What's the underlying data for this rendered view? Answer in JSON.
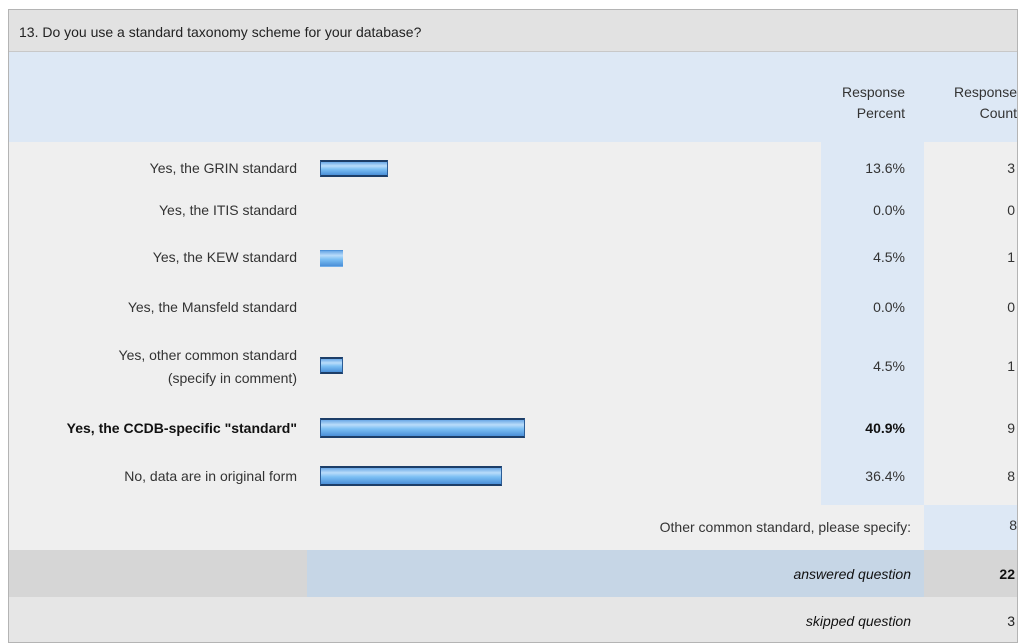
{
  "question": "13. Do you use a standard taxonomy scheme for your database?",
  "columns": {
    "percent_line1": "Response",
    "percent_line2": "Percent",
    "count_line1": "Response",
    "count_line2": "Count"
  },
  "chart_data": {
    "type": "bar",
    "title": "13. Do you use a standard taxonomy scheme for your database?",
    "orientation": "horizontal",
    "categories": [
      "Yes, the GRIN standard",
      "Yes, the ITIS standard",
      "Yes, the KEW standard",
      "Yes, the Mansfeld standard",
      "Yes, other common standard (specify in comment)",
      "Yes, the CCDB-specific \"standard\"",
      "No, data are in original form"
    ],
    "series": [
      {
        "name": "Response Percent",
        "values": [
          13.6,
          0.0,
          4.5,
          0.0,
          4.5,
          40.9,
          36.4
        ]
      },
      {
        "name": "Response Count",
        "values": [
          3,
          0,
          1,
          0,
          1,
          9,
          8
        ]
      }
    ],
    "xlim": [
      0,
      100
    ],
    "colors": {
      "bar": "#7dc0f4",
      "bar_border": "#1d3e68"
    }
  },
  "rows": [
    {
      "label": "Yes, the GRIN standard",
      "percent": "13.6%",
      "count": "3"
    },
    {
      "label": "Yes, the ITIS standard",
      "percent": "0.0%",
      "count": "0"
    },
    {
      "label": "Yes, the KEW standard",
      "percent": "4.5%",
      "count": "1"
    },
    {
      "label": "Yes, the Mansfeld standard",
      "percent": "0.0%",
      "count": "0"
    },
    {
      "label_line1": "Yes, other common standard",
      "label_line2": "(specify in comment)",
      "percent": "4.5%",
      "count": "1"
    },
    {
      "label": "Yes, the CCDB-specific \"standard\"",
      "percent": "40.9%",
      "count": "9"
    },
    {
      "label": "No, data are in original form",
      "percent": "36.4%",
      "count": "8"
    }
  ],
  "other": {
    "label": "Other common standard, please specify:",
    "count": "8"
  },
  "summary": {
    "answered_label": "answered question",
    "answered_value": "22",
    "skipped_label": "skipped question",
    "skipped_value": "3"
  },
  "colors": {
    "header_bg": "#e2e2e2",
    "column_header_bg": "#dde8f5",
    "body_bg": "#efefef",
    "answered_bg": "#c6d6e6"
  }
}
